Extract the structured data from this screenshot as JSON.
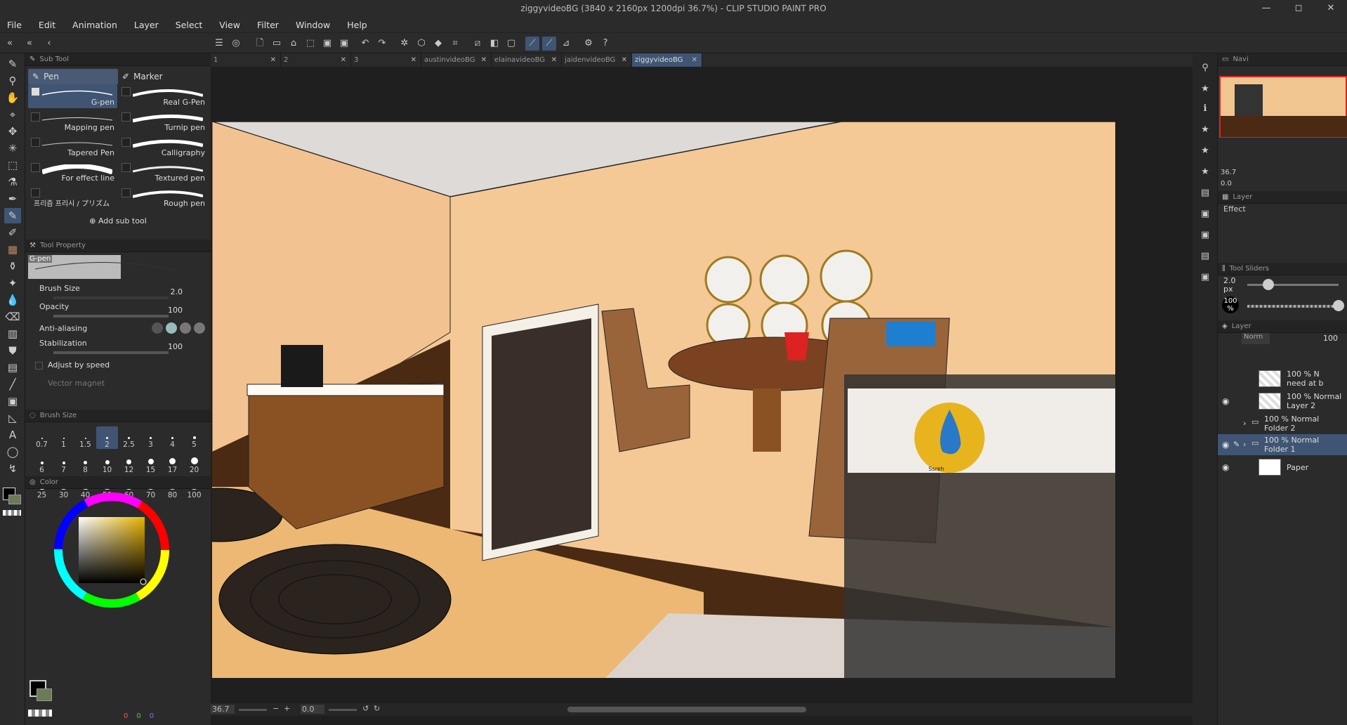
{
  "window": {
    "title": "ziggyvideoBG (3840 x 2160px 1200dpi 36.7%)  - CLIP STUDIO PAINT PRO",
    "min": "—",
    "max": "◻",
    "close": "✕"
  },
  "menu": [
    "File",
    "Edit",
    "Animation",
    "Layer",
    "Select",
    "View",
    "Filter",
    "Window",
    "Help"
  ],
  "subtool": {
    "panel_title": "Sub Tool",
    "groups": [
      "Pen",
      "Marker"
    ],
    "brushes": [
      "G-pen",
      "Real G-Pen",
      "Mapping pen",
      "Turnip pen",
      "Tapered Pen",
      "Calligraphy",
      "For effect line",
      "Textured pen",
      "프리즘 프리시 / プリズム",
      "Rough pen"
    ],
    "add_label": "Add sub tool"
  },
  "tool_property": {
    "panel_title": "Tool Property",
    "preview_name": "G-pen",
    "brush_size_label": "Brush Size",
    "brush_size_value": "2.0",
    "opacity_label": "Opacity",
    "opacity_value": "100",
    "antialias_label": "Anti-aliasing",
    "stabilization_label": "Stabilization",
    "stabilization_value": "100",
    "adjust_label": "Adjust by speed",
    "vector_label": "Vector magnet"
  },
  "brush_size": {
    "panel_title": "Brush Size",
    "sizes": [
      "0.7",
      "1",
      "1.5",
      "2",
      "2.5",
      "3",
      "4",
      "5",
      "6",
      "7",
      "8",
      "10",
      "12",
      "15",
      "17",
      "20",
      "25",
      "30",
      "40",
      "50",
      "60",
      "70",
      "80",
      "100"
    ]
  },
  "color": {
    "panel_title": "Color",
    "r": "0",
    "g": "0",
    "b": "0"
  },
  "doc_tabs": [
    "1",
    "2",
    "3",
    "austinvideoBG",
    "elainavideoBG",
    "jaidenvideoBG",
    "ziggyvideoBG"
  ],
  "status": {
    "zoom": "36.7",
    "angle": "0.0"
  },
  "navigator": {
    "label": "Navi",
    "zoom": "36.7",
    "rotation": "0.0",
    "layer_tab": "Layer",
    "effect_label": "Effect"
  },
  "tool_sliders": {
    "title": "Tool Sliders",
    "size": "2.0",
    "size_unit": "px",
    "opacity": "100",
    "opacity_unit": "%"
  },
  "layer_panel": {
    "title": "Layer",
    "blend": "Norm",
    "opacity": "100",
    "layers": [
      {
        "line1": "100 % N",
        "line2": "need at b"
      },
      {
        "line1": "100 % Normal",
        "line2": "Layer 2"
      },
      {
        "line1": "100 % Normal",
        "line2": "Folder 2"
      },
      {
        "line1": "100 % Normal",
        "line2": "Folder 1"
      },
      {
        "line1": "",
        "line2": "Paper"
      }
    ]
  },
  "art": {
    "signature": "Ssreh"
  }
}
